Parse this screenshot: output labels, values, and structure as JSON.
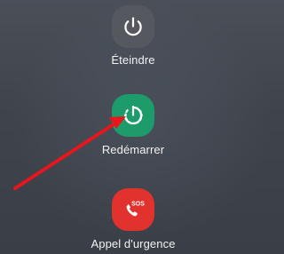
{
  "power_menu": {
    "items": [
      {
        "label": "Éteindre",
        "icon": "power-icon",
        "background": "#55595f"
      },
      {
        "label": "Redémarrer",
        "icon": "restart-icon",
        "background": "#1e9b6a"
      },
      {
        "label": "Appel d'urgence",
        "icon": "sos-phone-icon",
        "icon_text": "SOS",
        "background": "#e2322e"
      }
    ]
  },
  "annotation": {
    "arrow_color": "#e8161c"
  }
}
